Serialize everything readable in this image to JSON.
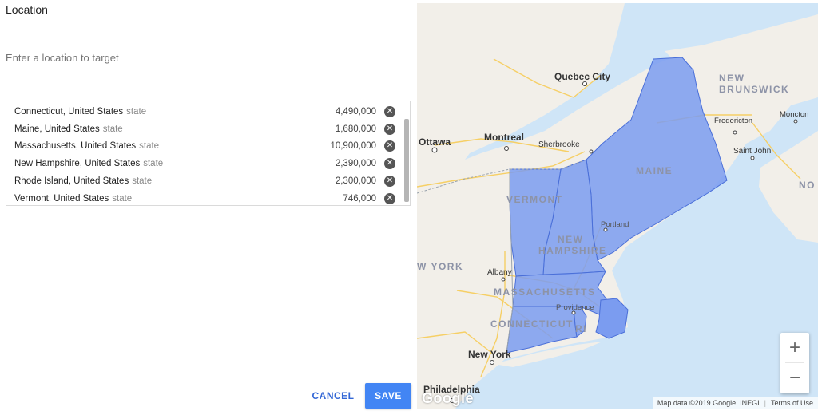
{
  "location_section": {
    "title": "Location",
    "search": {
      "placeholder": "Enter a location to target",
      "value": ""
    },
    "targets": [
      {
        "name": "Connecticut, United States",
        "type": "state",
        "reach": "4,490,000"
      },
      {
        "name": "Maine, United States",
        "type": "state",
        "reach": "1,680,000"
      },
      {
        "name": "Massachusetts, United States",
        "type": "state",
        "reach": "10,900,000"
      },
      {
        "name": "New Hampshire, United States",
        "type": "state",
        "reach": "2,390,000"
      },
      {
        "name": "Rhode Island, United States",
        "type": "state",
        "reach": "2,300,000"
      },
      {
        "name": "Vermont, United States",
        "type": "state",
        "reach": "746,000"
      }
    ],
    "remove_icon": "close-circle-icon"
  },
  "actions": {
    "cancel_label": "CANCEL",
    "save_label": "SAVE"
  },
  "map": {
    "state_labels": {
      "maine": "MAINE",
      "vermont": "VERMONT",
      "new_hampshire_1": "NEW",
      "new_hampshire_2": "HAMPSHIRE",
      "massachusetts": "MASSACHUSETTS",
      "connecticut": "CONNECTICUT",
      "rhode_island": "RI",
      "new_york": "W YORK",
      "new_brunswick_1": "NEW",
      "new_brunswick_2": "BRUNSWICK",
      "nova_scotia": "NO"
    },
    "city_labels": {
      "quebec_city": "Quebec City",
      "ottawa": "Ottawa",
      "montreal": "Montreal",
      "sherbrooke": "Sherbrooke",
      "fredericton": "Fredericton",
      "moncton": "Moncton",
      "saint_john": "Saint John",
      "portland": "Portland",
      "albany": "Albany",
      "providence": "Providence",
      "new_york": "New York",
      "philadelphia": "Philadelphia"
    },
    "zoom_in_label": "+",
    "zoom_out_label": "−",
    "attribution": "Map data ©2019 Google, INEGI",
    "terms_label": "Terms of Use",
    "logo_text": "Google",
    "colors": {
      "water": "#cfe5f7",
      "land": "#f2efe9",
      "highlight_fill": "#7b9cf0",
      "highlight_stroke": "#4a6fd8",
      "accent": "#4285f4"
    }
  }
}
